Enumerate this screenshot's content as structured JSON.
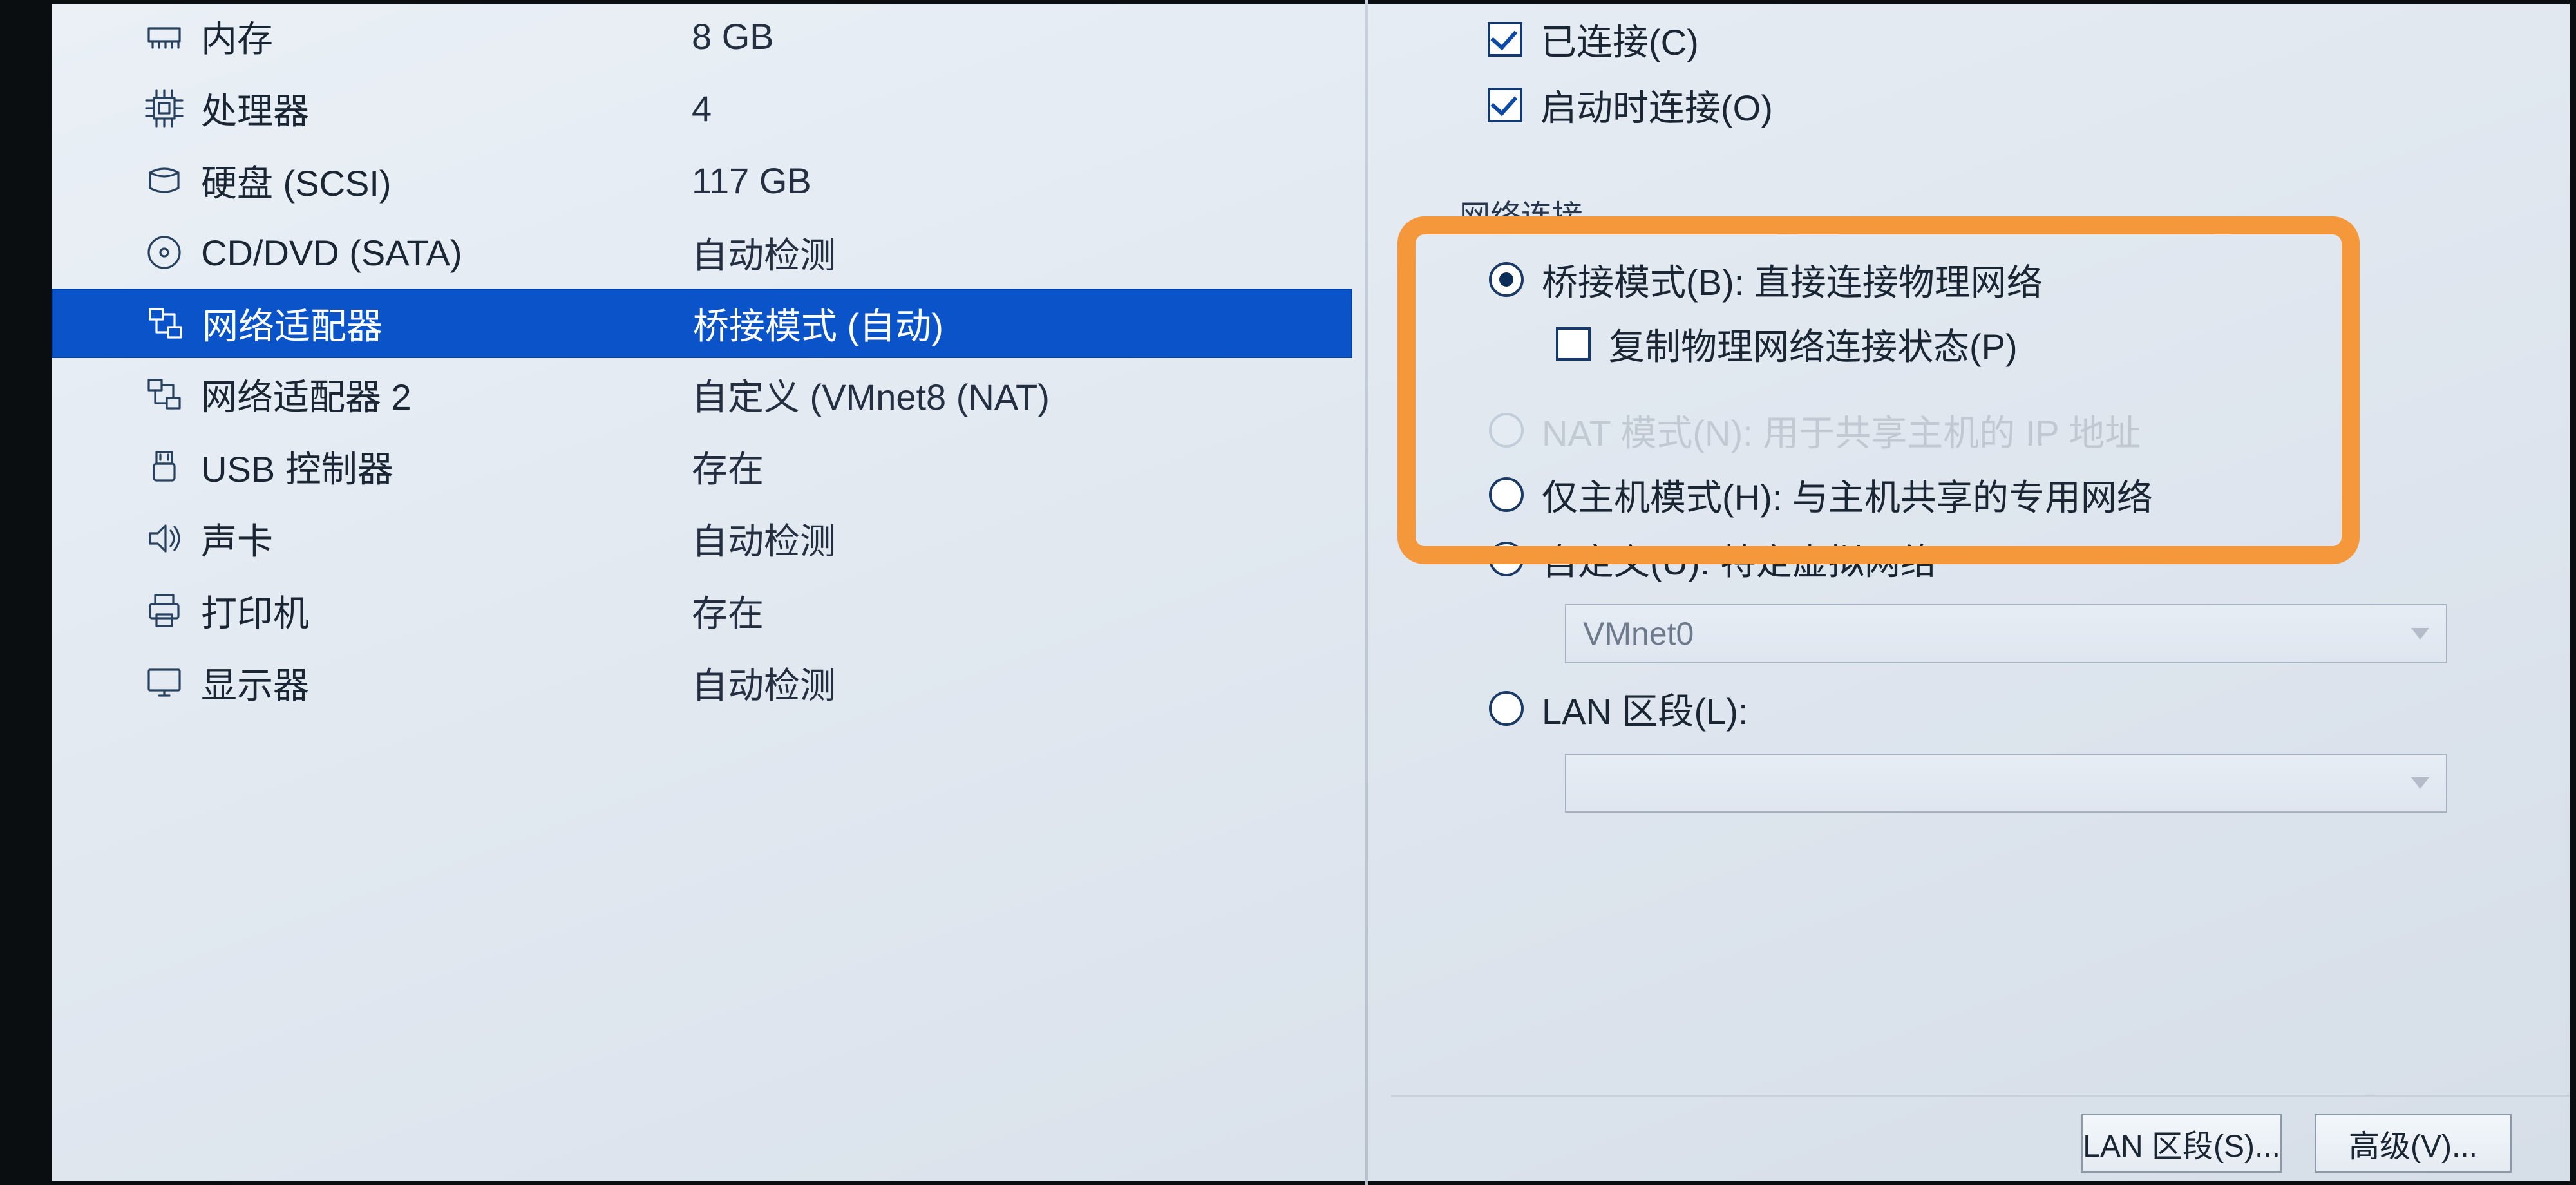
{
  "devices": [
    {
      "key": "memory",
      "name": "内存",
      "value": "8 GB",
      "icon": "memory-icon"
    },
    {
      "key": "cpu",
      "name": "处理器",
      "value": "4",
      "icon": "cpu-icon"
    },
    {
      "key": "hdd",
      "name": "硬盘 (SCSI)",
      "value": "117 GB",
      "icon": "hdd-icon"
    },
    {
      "key": "cd",
      "name": "CD/DVD (SATA)",
      "value": "自动检测",
      "icon": "cd-icon"
    },
    {
      "key": "net1",
      "name": "网络适配器",
      "value": "桥接模式 (自动)",
      "icon": "network-icon",
      "selected": true
    },
    {
      "key": "net2",
      "name": "网络适配器 2",
      "value": "自定义 (VMnet8 (NAT)",
      "icon": "network-icon"
    },
    {
      "key": "usb",
      "name": "USB 控制器",
      "value": "存在",
      "icon": "usb-icon"
    },
    {
      "key": "audio",
      "name": "声卡",
      "value": "自动检测",
      "icon": "audio-icon"
    },
    {
      "key": "printer",
      "name": "打印机",
      "value": "存在",
      "icon": "printer-icon"
    },
    {
      "key": "display",
      "name": "显示器",
      "value": "自动检测",
      "icon": "display-icon"
    }
  ],
  "device_status": {
    "connected_label": "已连接(C)",
    "connect_at_poweron_label": "启动时连接(O)"
  },
  "network": {
    "group_title": "网络连接",
    "bridged_label": "桥接模式(B): 直接连接物理网络",
    "replicate_label": "复制物理网络连接状态(P)",
    "nat_label": "NAT 模式(N): 用于共享主机的 IP 地址",
    "hostonly_label": "仅主机模式(H): 与主机共享的专用网络",
    "custom_label": "自定义(U): 特定虚拟网络",
    "custom_value": "VMnet0",
    "lan_label": "LAN 区段(L):",
    "lan_value": ""
  },
  "buttons": {
    "lan_segments": "LAN 区段(S)...",
    "advanced": "高级(V)..."
  }
}
